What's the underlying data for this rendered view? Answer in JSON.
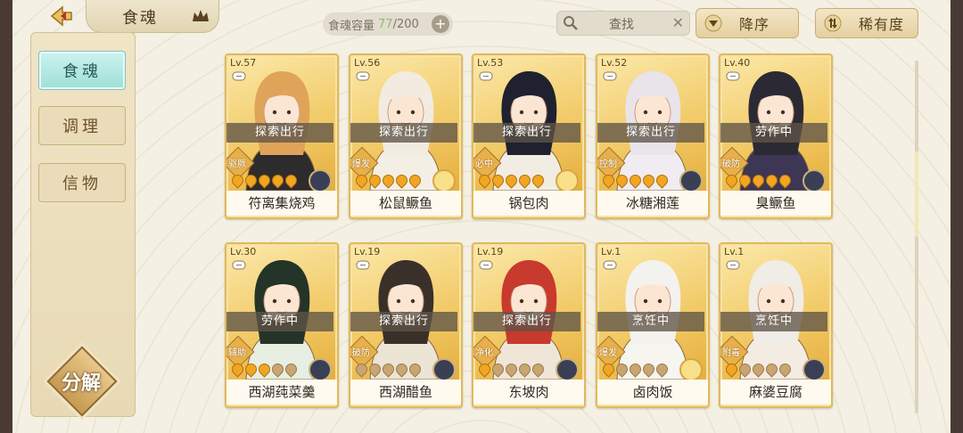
{
  "header": {
    "title": "食魂",
    "capacity_label": "食魂容量",
    "capacity_current": "77",
    "capacity_max": "/200",
    "plus": "+",
    "search_label": "查找",
    "search_clear": "✕",
    "sort_order": "降序",
    "sort_by": "稀有度"
  },
  "sidebar": {
    "tabs": [
      {
        "label": "食魂",
        "active": true
      },
      {
        "label": "调理",
        "active": false
      },
      {
        "label": "信物",
        "active": false
      }
    ],
    "decompose_label": "分解"
  },
  "icons": {
    "back": "back-arrow-icon",
    "crown": "crown-icon",
    "search": "magnifier-icon",
    "sort_desc": "triangle-down-icon",
    "sort_rare": "sort-arrows-icon"
  },
  "cards": [
    {
      "level": "Lv.57",
      "status": "探索出行",
      "role": "驱厥",
      "name": "符离集烧鸡",
      "stars": 5,
      "lit": 5,
      "elem": "dark",
      "hair": "#e0a35a",
      "coat": "#2e2b2c"
    },
    {
      "level": "Lv.56",
      "status": "探索出行",
      "role": "爆发",
      "name": "松鼠鳜鱼",
      "stars": 5,
      "lit": 5,
      "elem": "gold",
      "hair": "#f2ebe0",
      "coat": "#f4efe5"
    },
    {
      "level": "Lv.53",
      "status": "探索出行",
      "role": "必中",
      "name": "锅包肉",
      "stars": 5,
      "lit": 5,
      "elem": "gold",
      "hair": "#1f2130",
      "coat": "#f2ede2"
    },
    {
      "level": "Lv.52",
      "status": "探索出行",
      "role": "控制",
      "name": "冰糖湘莲",
      "stars": 5,
      "lit": 5,
      "elem": "dark",
      "hair": "#e8e4ea",
      "coat": "#f0ecf2"
    },
    {
      "level": "Lv.40",
      "status": "劳作中",
      "role": "破防",
      "name": "臭鳜鱼",
      "stars": 5,
      "lit": 5,
      "elem": "dark",
      "hair": "#2b2a34",
      "coat": "#3d3654"
    },
    {
      "level": "Lv.30",
      "status": "劳作中",
      "role": "辅助",
      "name": "西湖莼菜羹",
      "stars": 5,
      "lit": 3,
      "elem": "dark",
      "hair": "#243428",
      "coat": "#e6efe2"
    },
    {
      "level": "Lv.19",
      "status": "探索出行",
      "role": "破防",
      "name": "西湖醋鱼",
      "stars": 5,
      "lit": 0,
      "elem": "dark",
      "hair": "#3a302a",
      "coat": "#ece4d4"
    },
    {
      "level": "Lv.19",
      "status": "探索出行",
      "role": "净化",
      "name": "东坡肉",
      "stars": 5,
      "lit": 1,
      "elem": "dark",
      "hair": "#c8392e",
      "coat": "#f0e6d8"
    },
    {
      "level": "Lv.1",
      "status": "烹饪中",
      "role": "爆发",
      "name": "卤肉饭",
      "stars": 5,
      "lit": 1,
      "elem": "gold",
      "hair": "#f4f2ee",
      "coat": "#f7f5f0"
    },
    {
      "level": "Lv.1",
      "status": "烹饪中",
      "role": "附毒",
      "name": "麻婆豆腐",
      "stars": 5,
      "lit": 1,
      "elem": "dark",
      "hair": "#f0ece6",
      "coat": "#f3ece2"
    }
  ]
}
